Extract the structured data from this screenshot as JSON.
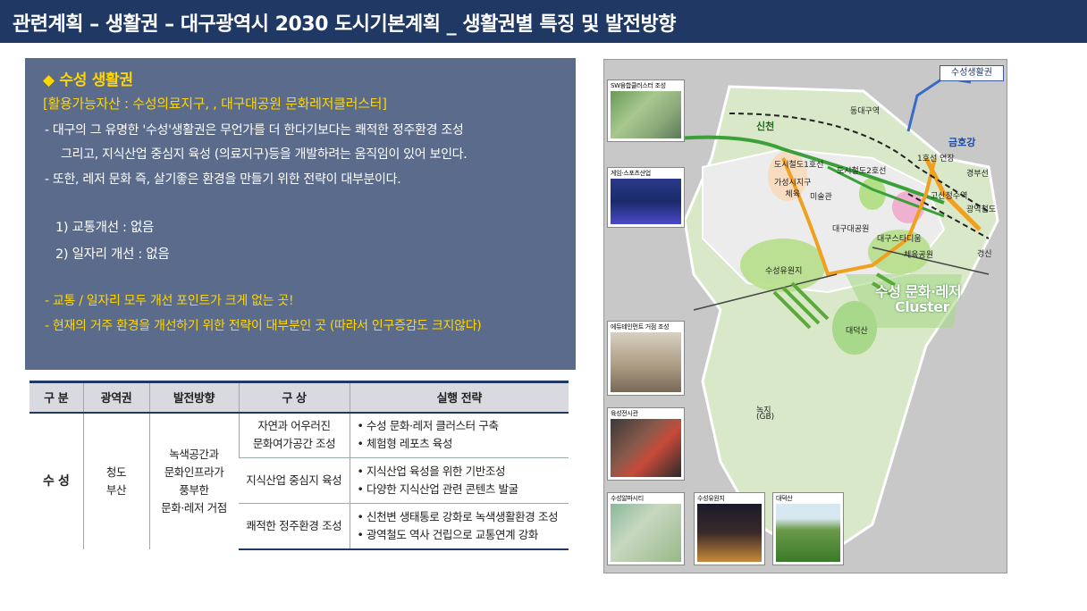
{
  "header": {
    "title": "관련계획 – 생활권 – 대구광역시 2030 도시기본계획 _ 생활권별 특징 및 발전방향"
  },
  "panel": {
    "heading": "◆ 수성 생활권",
    "assets": "[활용가능자산 : 수성의료지구,  , 대구대공원 문화레저클러스터]",
    "bullet1a": "-  대구의 그 유명한 '수성'생활권은 무언가를 더 한다기보다는 쾌적한 정주환경 조성",
    "bullet1b": "그리고, 지식산업 중심지 육성 (의료지구)등을 개발하려는 움직임이 있어 보인다.",
    "bullet2": "-  또한, 레저 문화 즉, 살기좋은 환경을 만들기 위한 전략이 대부분이다.",
    "num1": "1)  교통개선 : 없음",
    "num2": "2)  일자리 개선 : 없음",
    "conclusion1": "-  교통 / 일자리 모두 개선 포인트가 크게 없는 곳!",
    "conclusion2": "-  현재의 거주 환경을 개선하기 위한 전략이 대부분인 곳 (따라서 인구증감도 크지않다)"
  },
  "table": {
    "headers": [
      "구 분",
      "광역권",
      "발전방향",
      "구 상",
      "실행 전략"
    ],
    "region": "수 성",
    "area": "청도\n부산",
    "direction": "녹색공간과\n문화인프라가\n풍부한\n문화·레저 거점",
    "rows": [
      {
        "concept": "자연과 어우러진\n문화여가공간 조성",
        "plan": "• 수성 문화·레저 클러스터 구축\n• 체험형 레포츠 육성"
      },
      {
        "concept": "지식산업 중심지 육성",
        "plan": "• 지식산업 육성을 위한 기반조성\n• 다양한 지식산업 관련 콘텐츠 발굴"
      },
      {
        "concept": "쾌적한 정주환경 조성",
        "plan": "• 신천변 생태통로 강화로 녹색생활환경 조성\n• 광역철도 역사 건립으로 교통연계 강화"
      }
    ]
  },
  "map": {
    "tag": "수성생활권",
    "labels": {
      "cluster_a": "수성 문화·레저",
      "cluster_b": "Cluster",
      "shincheon": "신천",
      "geumho": "금호강",
      "gyeongbu": "경부선",
      "gwangyeok": "광역철도",
      "dongdae": "동대구역",
      "line1": "도시철도1호선",
      "line2": "도시철도2호선",
      "ext1": "1호선 연장",
      "gosan": "고산정수역",
      "daegu_park": "대구대공원",
      "golf": "체육공원",
      "suseong_park": "수성유원지",
      "daedeok": "대덕산",
      "greenbelt": "녹지",
      "gb": "(GB)",
      "mindae": "미술관",
      "gyeongsin": "경신",
      "daegu_stadium": "대구스타디움",
      "sinhyeon": "가성시지구\n체육"
    },
    "thumbs": [
      {
        "caption": "SW융합클러스터 조성"
      },
      {
        "caption": "게임·스포츠산업"
      },
      {
        "caption": "에듀테인먼트 거점 조성"
      },
      {
        "caption": "육성전시관"
      },
      {
        "caption": "수성알파시티"
      },
      {
        "caption": "수성유원지"
      },
      {
        "caption": "대덕산"
      }
    ]
  },
  "colors": {
    "header_bg": "#1f3864",
    "panel_bg": "#5b6b8c",
    "highlight_yellow": "#ffd700",
    "map_green": "#a8d88a"
  }
}
